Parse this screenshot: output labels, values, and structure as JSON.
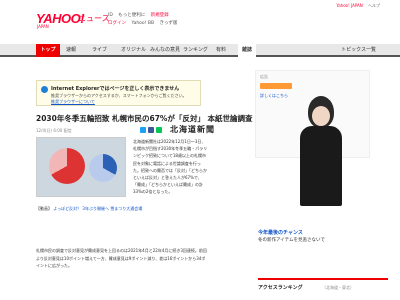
{
  "header": {
    "logo": "YAHOO!",
    "logo_sub": "JAPAN",
    "news_label": "ニュース",
    "links_row1": [
      "ID",
      "もっと便利に",
      "新規登録"
    ],
    "links_row2": [
      "ログイン",
      "Yahoo! BB",
      "きっず版"
    ],
    "right_links": [
      "Yahoo! JAPAN",
      "ヘルプ"
    ]
  },
  "nav": {
    "items": [
      "トップ",
      "速報",
      "ライブ",
      "オリジナル",
      "みんなの意見",
      "ランキング",
      "有料",
      "雑誌"
    ],
    "right": "トピックス一覧"
  },
  "banner": {
    "title": "Internet Explorerではページを正しく表示できません",
    "text": "推奨ブラウザーからのアクセスするか、スマートフォンからご覧ください。",
    "link": "推奨ブラウザーについて"
  },
  "article": {
    "title": "2030年冬季五輪招致 札幌市民の67%が「反対」 本紙世論調査",
    "meta": "12/4(日) 6:00 配信",
    "source_logo": "北海道新聞",
    "body": "北海道新聞社は2022年12月1日～3日、札幌市が目指す2030年冬季五輪・パラリンピック招致について18歳以上の札幌市民を対象に電話による世論調査を行った。招致への賛否では「反対」「どちらかといえば反対」と答えた人が67%で、「賛成」「どちらかといえば賛成」の計33%の2倍となった。",
    "related_label": "【動画】",
    "related_links": "よっぽど反対？ 3年ぶり開催へ 雪まつり大通会場",
    "paragraph": "札幌市民の調査で反対意見が賛成意見を上回るのは2021年4月と22年4月に続き3回連続。前回より反対意見は10ポイント増えて一方、賛成意見は9ポイント減り、差は16ポイントから34ポイントに広がった。"
  },
  "sidebar": {
    "ad_label": "広告",
    "ad_link": "詳しくはこちら",
    "caption_title": "今年最後のチャンス",
    "caption_text": "冬の新作アイテムを見逃さないで",
    "access_title": "アクセスランキング",
    "access_sub": "（北海道・東北）"
  },
  "colors": {
    "brand": "#ff0033",
    "nav_top": "#ee0000",
    "link": "#1155cc"
  }
}
